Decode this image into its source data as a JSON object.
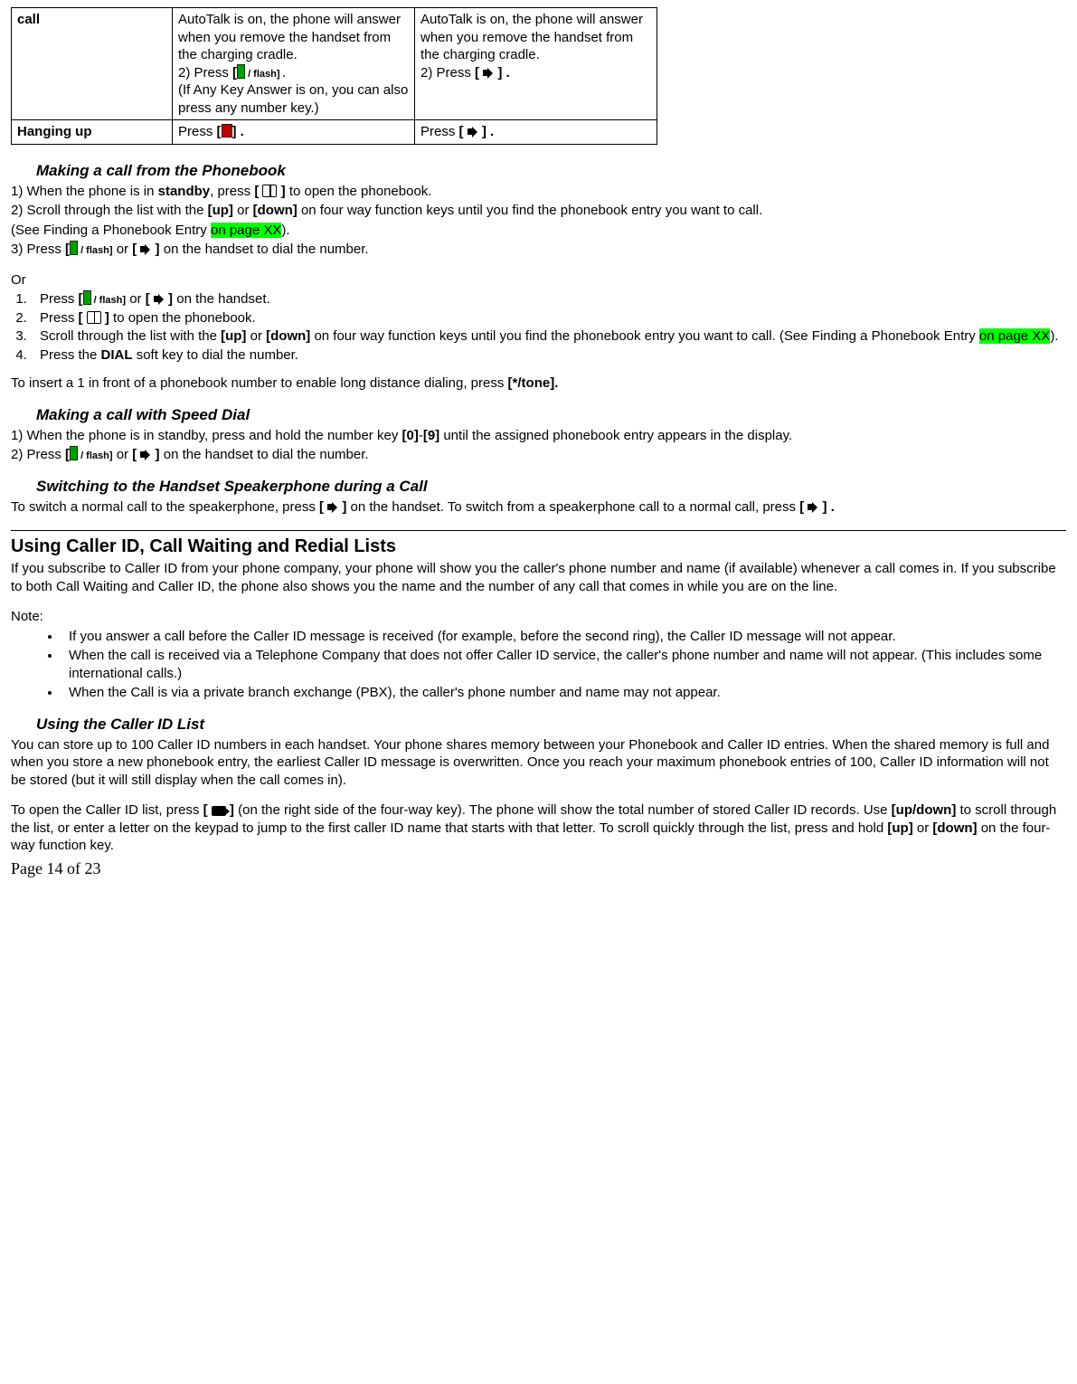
{
  "table": {
    "row1": {
      "label": "call",
      "c2_line1": "AutoTalk is on, the phone will answer when you remove the handset from the charging cradle.",
      "c2_line2a": "2) Press ",
      "c2_press_open": "[",
      "c2_flash": " / flash] .",
      "c2_line3": "(If Any Key Answer is on, you can also press any number key.)",
      "c3_line1": "AutoTalk is on, the phone will answer when you remove the handset from the charging cradle.",
      "c3_line2a": "2) Press ",
      "c3_press_open": "[ ",
      "c3_close": " ] ."
    },
    "row2": {
      "label": "Hanging up",
      "c2_a": " Press ",
      "c2_open": "[",
      "c2_close": "] .",
      "c3_a": "Press ",
      "c3_open": "[ ",
      "c3_close": " ] ."
    }
  },
  "phonebook": {
    "heading": "Making a call from the Phonebook",
    "l1a": "1) When the phone is in ",
    "l1b": "standby",
    "l1c": ", press ",
    "l1_open": "[ ",
    "l1_close": " ]",
    "l1d": " to open the phonebook.",
    "l2a": "2) Scroll through the list with the ",
    "l2_up": "[up]",
    "l2b": " or ",
    "l2_down": "[down]",
    "l2c": " on four way function keys until you find the phonebook entry you want to call.",
    "l3a": "(See Finding a Phonebook Entry ",
    "l3_hl": "on page XX",
    "l3b": ").",
    "l4a": "3) Press ",
    "l4_open1": "[",
    "l4_flash": " / flash]",
    "l4_or": " or ",
    "l4_open2": "[ ",
    "l4_close2": " ]",
    "l4b": " on the handset to dial the number.",
    "or": "Or",
    "ol1a": "Press ",
    "ol1_open1": "[",
    "ol1_flash": " / flash]",
    "ol1_or": " or ",
    "ol1_open2": "[ ",
    "ol1_close2": " ]",
    "ol1b": " on the handset.",
    "ol2a": "Press ",
    "ol2_open": "[ ",
    "ol2_close": " ]",
    "ol2b": " to open the phonebook.",
    "ol3a": "Scroll through the list with the ",
    "ol3_up": "[up]",
    "ol3_or": " or ",
    "ol3_down": "[down]",
    "ol3b": " on four way function keys until you find the phonebook entry you want to call. (See Finding a Phonebook Entry ",
    "ol3_hl": "on page XX",
    "ol3c": ").",
    "ol4a": "Press the ",
    "ol4_dial": "DIAL",
    "ol4b": " soft key to dial the number.",
    "insert_a": "To insert a 1 in front of a phonebook number to enable long distance dialing, press ",
    "insert_b": "[*/tone]."
  },
  "speed": {
    "heading": "Making a call with Speed Dial",
    "l1a": "1) When the phone is in standby, press and hold the number key ",
    "l1_0": "[0]",
    "l1_dash": "-",
    "l1_9": "[9]",
    "l1b": " until the assigned phonebook entry appears in the display.",
    "l2a": "2) Press ",
    "l2_open1": "[",
    "l2_flash": " / flash]",
    "l2_or": " or ",
    "l2_open2": "[ ",
    "l2_close2": " ]",
    "l2b": " on the handset to dial the number."
  },
  "speaker": {
    "heading": "Switching to the Handset Speakerphone during a Call",
    "l1a": "To switch a normal call to the speakerphone, press ",
    "l1_open": "[ ",
    "l1_close": " ]",
    "l1b": " on the handset. To switch from a speakerphone call to a normal call, press ",
    "l1_open2": "[ ",
    "l1_close2": " ] ."
  },
  "cid": {
    "heading": "Using Caller ID, Call Waiting and Redial Lists",
    "p1": "If you subscribe to Caller ID from your phone company, your phone will show you the caller's phone number and name (if available) whenever a call comes in. If you subscribe to both Call Waiting and Caller ID, the phone also shows you the name and the number of any call that comes in while you are on the line.",
    "note": "Note:",
    "b1": "If you answer a call before the Caller ID message is received (for example, before the second ring), the Caller ID message will not appear.",
    "b2": "When the call is received via a Telephone Company that does not offer Caller ID service, the caller's phone number and name will not appear. (This includes some international calls.)",
    "b3": "When the Call is via a private branch exchange (PBX), the caller's phone number and name may not appear.",
    "sub_heading": "Using the Caller ID List",
    "p2": "You can store up to 100 Caller ID numbers in each handset. Your phone shares memory between your Phonebook and Caller ID entries. When the shared memory is full and when you store a new phonebook entry, the earliest Caller ID message is overwritten. Once you reach your maximum phonebook entries of 100, Caller ID information will not be stored (but it will still display when the call comes in).",
    "p3a": "To open the Caller ID list, press  ",
    "p3_open": "[ ",
    "p3_close": " ]",
    "p3b": "  (on the right side of the four-way key). The phone will show the total number of stored Caller ID records. Use ",
    "p3_ud": "[up/down]",
    "p3c": " to scroll through the list, or enter a letter on the keypad to jump to the first caller ID name that starts with that letter. To scroll quickly through the list, press and hold ",
    "p3_up": "[up]",
    "p3d": " or ",
    "p3_down": "[down]",
    "p3e": " on the four-way function key."
  },
  "footer": "Page 14 of 23"
}
